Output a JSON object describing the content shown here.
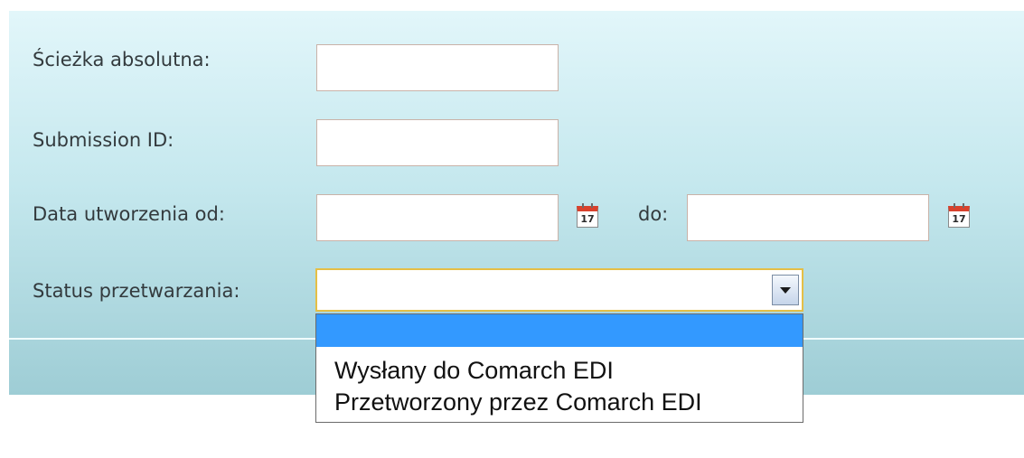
{
  "form": {
    "fields": [
      {
        "label": "Ścieżka absolutna:",
        "value": ""
      },
      {
        "label": "Submission ID:",
        "value": ""
      },
      {
        "label": "Data utworzenia od:",
        "value": ""
      }
    ],
    "date_to_label": "do:",
    "date_to_value": "",
    "status_label": "Status przetwarzania:",
    "status_selected": "",
    "calendar_icon_day": "17"
  },
  "dropdown": {
    "options": [
      "",
      "Wysłany do Comarch EDI",
      "Przetworzony przez Comarch EDI"
    ],
    "highlight_color": "#3399ff"
  },
  "colors": {
    "panel_top": "#e2f6fa",
    "panel_bottom": "#9ecdd5",
    "select_border": "#e5bf46",
    "calendar_red": "#d9412c"
  }
}
